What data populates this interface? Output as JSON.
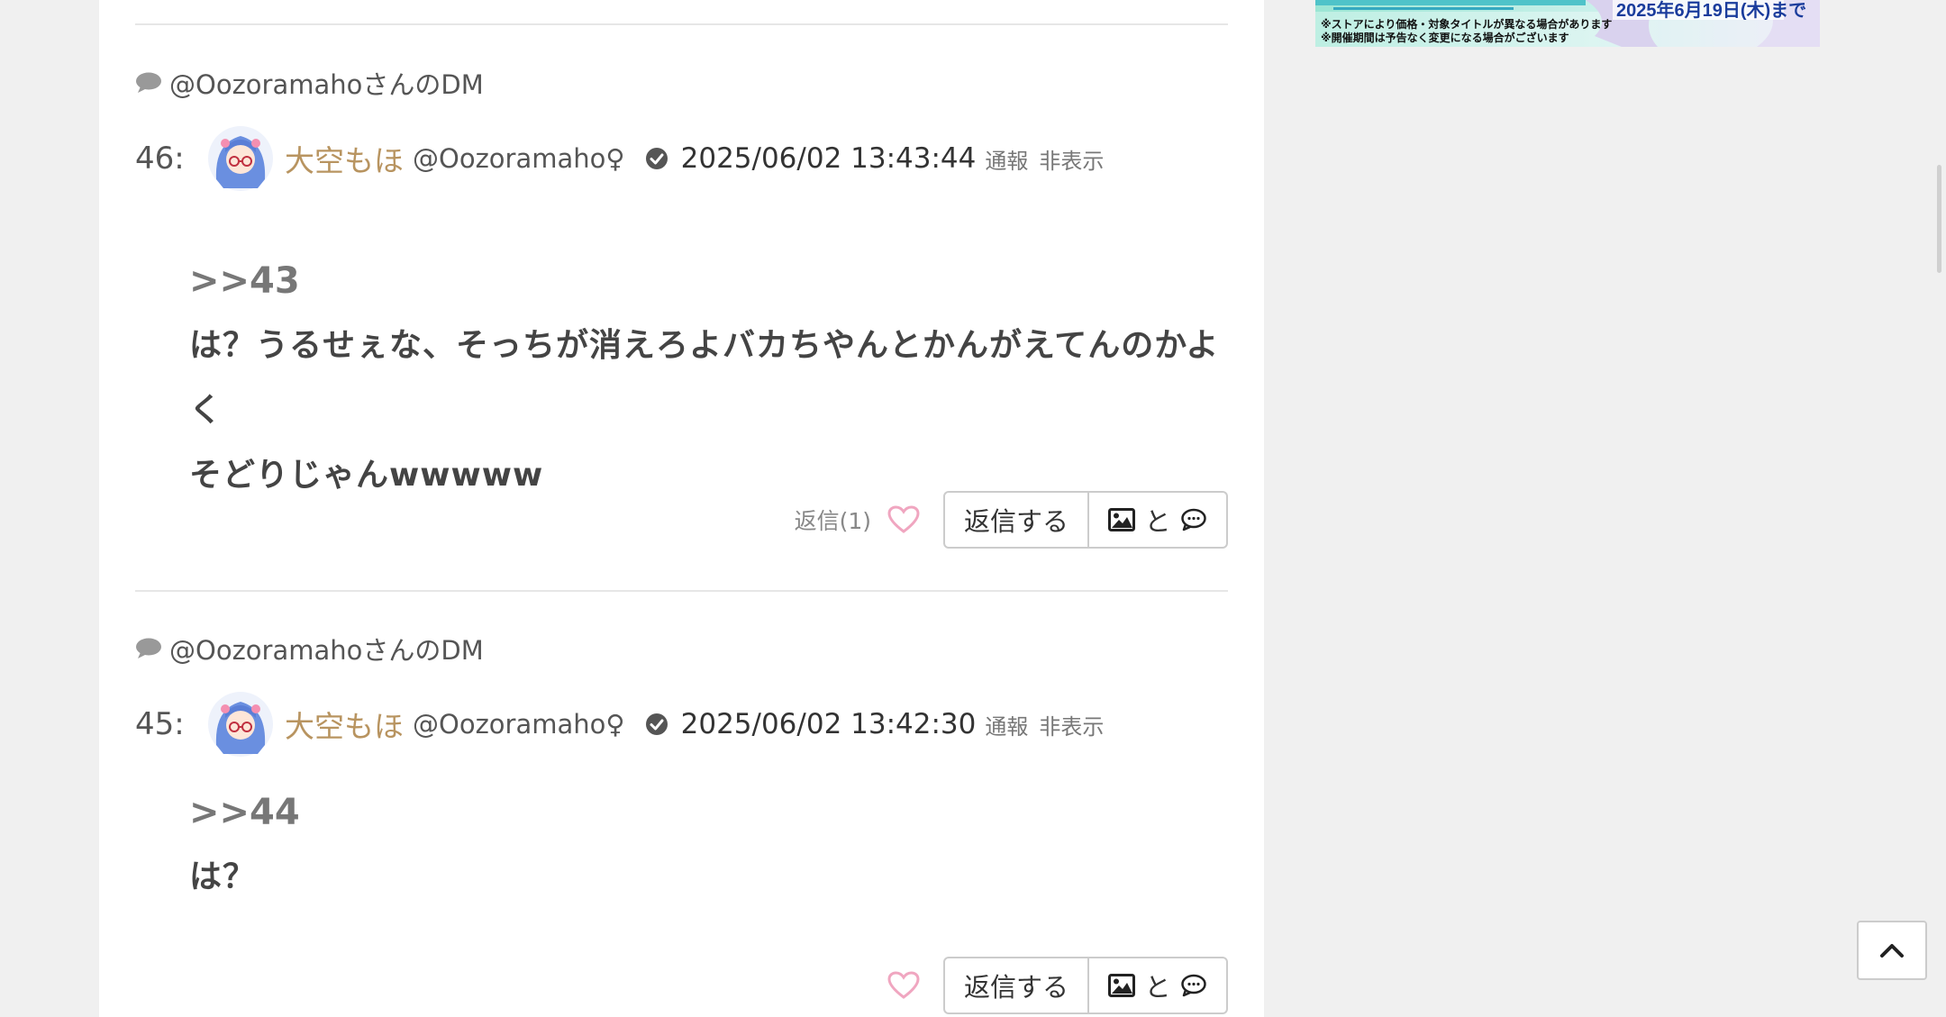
{
  "posts": [
    {
      "dm_label": "@OozoramahoさんのDM",
      "number": "46:",
      "user_name": "大空もほ",
      "user_id": "@Oozoramaho",
      "sex": "♀",
      "timestamp": "2025/06/02 13:43:44",
      "report_label": "通報",
      "hide_label": "非表示",
      "anchor": ">>43",
      "message_lines": [
        "は？うるせぇな、そっちが消えろよバカちやんとかんがえてんのかよく",
        "そどりじゃんwwwww"
      ],
      "reply_count": "返信(1)",
      "reply_button": "返信する",
      "image_button_text": "と"
    },
    {
      "dm_label": "@OozoramahoさんのDM",
      "number": "45:",
      "user_name": "大空もほ",
      "user_id": "@Oozoramaho",
      "sex": "♀",
      "timestamp": "2025/06/02 13:42:30",
      "report_label": "通報",
      "hide_label": "非表示",
      "anchor": ">>44",
      "message_lines": [
        "は？"
      ],
      "reply_button": "返信する",
      "image_button_text": "と"
    }
  ],
  "ad_banner": {
    "date": "2025年6月19日(木)まで",
    "note1": "※ストアにより価格・対象タイトルが異なる場合があります",
    "note2": "※開催期間は予告なく変更になる場合がございます"
  },
  "colors": {
    "username": "#b89460",
    "heart": "#f0a6c0",
    "ad_text": "#1a3c9c"
  },
  "icons": [
    "speech-bubble-icon",
    "check-circle-icon",
    "heart-icon",
    "image-icon",
    "comment-icon",
    "chevron-up-icon"
  ]
}
